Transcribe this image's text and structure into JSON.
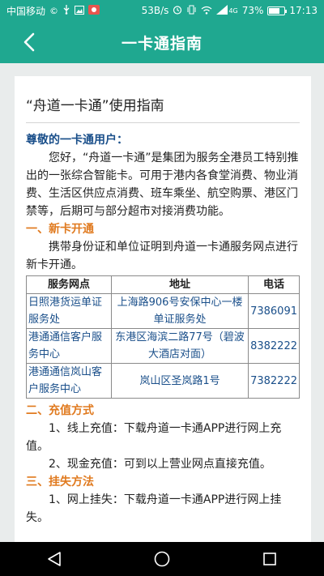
{
  "status_bar": {
    "carrier": "中国移动",
    "speed": "53B/s",
    "network": "4G",
    "battery_percent": "73%",
    "battery_level": 0.73,
    "time": "17:13",
    "icons_left": [
      "copyright-icon",
      "usb-icon",
      "image-icon",
      "app-icon"
    ],
    "icons_right": [
      "alarm-icon",
      "vibrate-icon",
      "wifi-icon",
      "signal-icon"
    ]
  },
  "header": {
    "title": "一卡通指南",
    "back_icon": "chevron-left-icon",
    "bg_color": "#1fa890"
  },
  "doc": {
    "title": "“舟道一卡通”使用指南",
    "greeting": "尊敬的一卡通用户：",
    "intro": "您好，“舟道一卡通”是集团为服务全港员工特别推出的一张综合智能卡。可用于港内各食堂消费、物业消费、生活区供应点消费、班车乘坐、航空购票、港区门禁等，后期可与部分超市对接消费功能。",
    "sec1_title": "一、新卡开通",
    "sec1_text": "携带身份证和单位证明到舟道一卡通服务网点进行新卡开通。",
    "table": {
      "headers": [
        "服务网点",
        "地址",
        "电话"
      ],
      "rows": [
        [
          "日照港货运单证服务处",
          "上海路906号安保中心一楼单证服务处",
          "7386091"
        ],
        [
          "港通通信客户服务中心",
          "东港区海滨二路77号（碧波大酒店对面）",
          "8382222"
        ],
        [
          "港通通信岚山客户服务中心",
          "岚山区圣岚路1号",
          "7382222"
        ]
      ]
    },
    "sec2_title": "二、充值方式",
    "sec2_item1": "1、线上充值：下载舟道一卡通APP进行网上充值。",
    "sec2_item2": "2、现金充值：可到以上营业网点直接充值。",
    "sec3_title": "三、挂失方法",
    "sec3_item1": "1、网上挂失：下载舟道一卡通APP进行网上挂失。"
  },
  "nav": {
    "back_icon": "triangle-back-icon",
    "home_icon": "circle-home-icon",
    "recents_icon": "square-recents-icon"
  }
}
